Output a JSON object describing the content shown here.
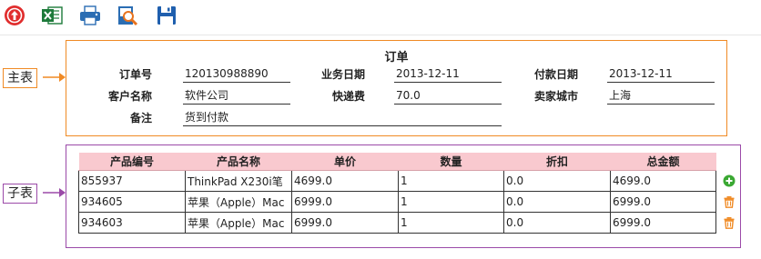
{
  "toolbar": {
    "items": [
      {
        "icon": "upload-circle-icon"
      },
      {
        "icon": "excel-icon"
      },
      {
        "icon": "printer-icon"
      },
      {
        "icon": "print-preview-icon"
      },
      {
        "icon": "save-icon"
      }
    ]
  },
  "labels": {
    "master": "主表",
    "detail": "子表"
  },
  "master": {
    "title": "订单",
    "fields": {
      "order_no": {
        "label": "订单号",
        "value": "120130988890"
      },
      "biz_date": {
        "label": "业务日期",
        "value": "2013-12-11"
      },
      "pay_date": {
        "label": "付款日期",
        "value": "2013-12-11"
      },
      "customer": {
        "label": "客户名称",
        "value": "软件公司"
      },
      "shipping": {
        "label": "快递费",
        "value": "70.0"
      },
      "seller_city": {
        "label": "卖家城市",
        "value": "上海"
      },
      "remark": {
        "label": "备注",
        "value": "货到付款"
      }
    }
  },
  "detail": {
    "columns": [
      "产品编号",
      "产品名称",
      "单价",
      "数量",
      "折扣",
      "总金额"
    ],
    "rows": [
      [
        "855937",
        "ThinkPad X230i笔",
        "4699.0",
        "1",
        "0.0",
        "4699.0"
      ],
      [
        "934605",
        "苹果（Apple）Mac",
        "6999.0",
        "1",
        "0.0",
        "6999.0"
      ],
      [
        "934603",
        "苹果（Apple）Mac",
        "6999.0",
        "1",
        "0.0",
        "6999.0"
      ]
    ]
  },
  "colors": {
    "master_border": "#f08a24",
    "detail_border": "#9b4aa8",
    "header_bg": "#f9c9cf",
    "add_green": "#3aa832",
    "delete_orange": "#f08a24"
  }
}
